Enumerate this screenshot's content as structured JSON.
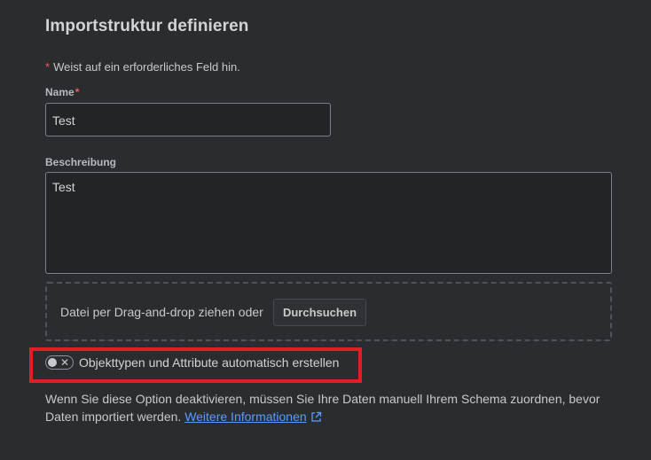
{
  "page": {
    "title": "Importstruktur definieren",
    "required_marker": "*",
    "required_note": "Weist auf ein erforderliches Feld hin."
  },
  "form": {
    "name": {
      "label": "Name",
      "required_marker": "*",
      "value": "Test"
    },
    "description": {
      "label": "Beschreibung",
      "value": "Test"
    },
    "upload": {
      "drop_text": "Datei per Drag-and-drop ziehen oder",
      "browse_label": "Durchsuchen"
    },
    "auto_create": {
      "label": "Objekttypen und Attribute automatisch erstellen",
      "enabled": false,
      "off_symbol": "✕",
      "helper_text": "Wenn Sie diese Option deaktivieren, müssen Sie Ihre Daten manuell Ihrem Schema zuordnen, bevor Daten importiert werden.",
      "link_text": "Weitere Informationen",
      "link_icon": "external-link-icon"
    }
  },
  "colors": {
    "background": "#2b2c2f",
    "required": "#f15b50",
    "link": "#579dff",
    "highlight": "#e01f25"
  }
}
